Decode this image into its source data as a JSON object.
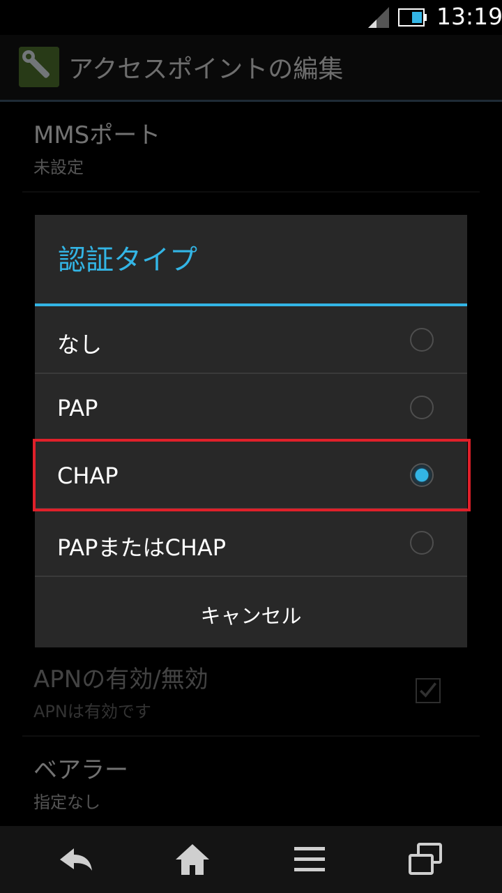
{
  "status": {
    "time": "13:19"
  },
  "app": {
    "title": "アクセスポイントの編集"
  },
  "list": {
    "items": [
      {
        "title": "MMSポート",
        "summary": "未設定"
      },
      {
        "title": "APNの有効/無効",
        "summary": "APNは有効です"
      },
      {
        "title": "ベアラー",
        "summary": "指定なし"
      }
    ]
  },
  "dialog": {
    "title": "認証タイプ",
    "options": [
      {
        "label": "なし"
      },
      {
        "label": "PAP"
      },
      {
        "label": "CHAP"
      },
      {
        "label": "PAPまたはCHAP"
      }
    ],
    "selected": "CHAP",
    "cancel_label": "キャンセル"
  },
  "colors": {
    "accent": "#33b5e5",
    "highlight": "#e0202a"
  },
  "icons": [
    "signal-icon",
    "battery-icon",
    "wrench-icon",
    "back-icon",
    "home-icon",
    "menu-icon",
    "recent-apps-icon"
  ]
}
